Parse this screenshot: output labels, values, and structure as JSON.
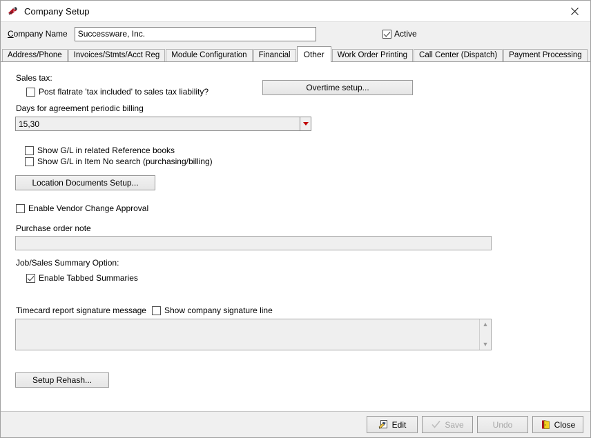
{
  "window": {
    "title": "Company Setup",
    "app_icon": "company-setup-icon",
    "close_label": "✕"
  },
  "header": {
    "company_label": "Company Name",
    "company_value": "Successware, Inc.",
    "company_placeholder": "Company Name",
    "active_label": "Active",
    "active_checked": true
  },
  "tabs": [
    {
      "label": "Address/Phone",
      "active": false
    },
    {
      "label": "Invoices/Stmts/Acct Reg",
      "active": false
    },
    {
      "label": "Module Configuration",
      "active": false
    },
    {
      "label": "Financial",
      "active": false
    },
    {
      "label": "Other",
      "active": true
    },
    {
      "label": "Work Order Printing",
      "active": false
    },
    {
      "label": "Call Center (Dispatch)",
      "active": false
    },
    {
      "label": "Payment Processing",
      "active": false
    }
  ],
  "panel": {
    "sales_tax_label": "Sales tax:",
    "post_flatrate_label": "Post flatrate 'tax included' to sales tax liability?",
    "post_flatrate_checked": false,
    "overtime_setup_button": "Overtime setup...",
    "days_billing_label": "Days for agreement periodic billing",
    "days_billing_value": "15,30",
    "show_gl_reference_label": "Show G/L in related Reference books",
    "show_gl_reference_checked": false,
    "show_gl_item_label": "Show G/L in Item No search (purchasing/billing)",
    "show_gl_item_checked": false,
    "location_documents_button": "Location Documents Setup...",
    "vendor_change_label": "Enable Vendor Change Approval",
    "vendor_change_checked": false,
    "purchase_order_note_label": "Purchase order note",
    "purchase_order_note_value": "",
    "job_sales_summary_label": "Job/Sales Summary Option:",
    "tabbed_summaries_label": "Enable Tabbed Summaries",
    "tabbed_summaries_checked": true,
    "timecard_label": "Timecard report signature message",
    "show_signature_line_label": "Show company signature line",
    "show_signature_line_checked": false,
    "timecard_message_value": "",
    "setup_rehash_button": "Setup Rehash...",
    "scroll_up_glyph": "▲",
    "scroll_down_glyph": "▼"
  },
  "footer": {
    "buttons": [
      {
        "label": "Edit",
        "icon": "edit-document-icon",
        "enabled": true
      },
      {
        "label": "Save",
        "icon": "checkmark-icon",
        "enabled": false
      },
      {
        "label": "Undo",
        "icon": "none",
        "enabled": false
      },
      {
        "label": "Close",
        "icon": "exit-door-icon",
        "enabled": true
      }
    ]
  },
  "colors": {
    "panel_bg": "#ffffff",
    "chrome_bg": "#f0f0f0",
    "field_bg": "#efefef",
    "border": "#9a9a9a",
    "accent_red": "#c00000",
    "door_yellow": "#f5d020",
    "disabled_text": "#a6a6a6"
  }
}
